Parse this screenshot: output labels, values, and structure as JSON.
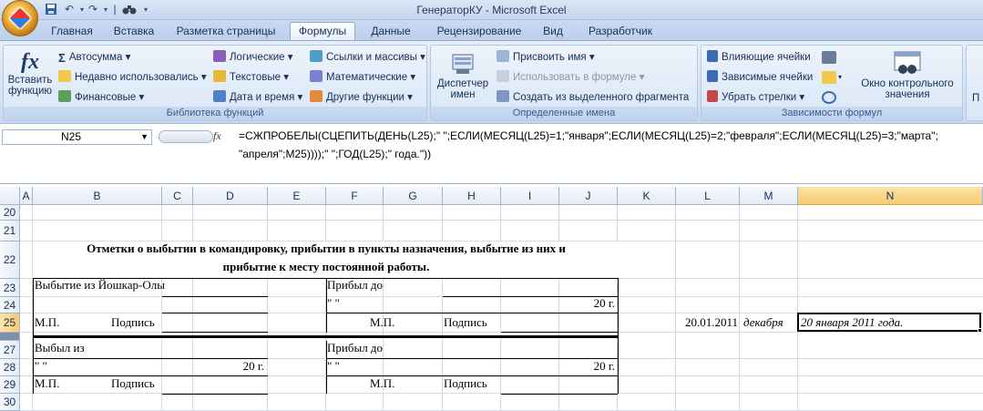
{
  "window": {
    "title": "ГенераторКУ - Microsoft Excel"
  },
  "tabs": [
    "Главная",
    "Вставка",
    "Разметка страницы",
    "Формулы",
    "Данные",
    "Рецензирование",
    "Вид",
    "Разработчик"
  ],
  "ribbon": {
    "insert_function": [
      "Вставить",
      "функцию"
    ],
    "lib": {
      "autosum": "Автосумма",
      "recent": "Недавно использовались",
      "financial": "Финансовые",
      "logical": "Логические",
      "text": "Текстовые",
      "datetime": "Дата и время",
      "lookup": "Ссылки и массивы",
      "math": "Математические",
      "more": "Другие функции",
      "label": "Библиотека функций"
    },
    "names": {
      "manager": [
        "Диспетчер",
        "имен"
      ],
      "define": "Присвоить имя",
      "use": "Использовать в формуле",
      "create": "Создать из выделенного фрагмента",
      "label": "Определенные имена"
    },
    "audit": {
      "precedents": "Влияющие ячейки",
      "dependents": "Зависимые ячейки",
      "remove": "Убрать стрелки",
      "watch": [
        "Окно контрольного",
        "значения"
      ],
      "label": "Зависимости формул"
    },
    "cut_label": "П"
  },
  "formula_bar": {
    "name_box": "N25",
    "fx": "fx",
    "formula": "=СЖПРОБЕЛЫ(СЦЕПИТЬ(ДЕНЬ(L25);\" \";ЕСЛИ(МЕСЯЦ(L25)=1;\"января\";ЕСЛИ(МЕСЯЦ(L25)=2;\"февраля\";ЕСЛИ(МЕСЯЦ(L25)=3;\"марта\";\n\"апреля\";M25))));\" \";ГОД(L25);\" года.\"))"
  },
  "columns": [
    "A",
    "B",
    "C",
    "D",
    "E",
    "F",
    "G",
    "H",
    "I",
    "J",
    "K",
    "L",
    "M",
    "N"
  ],
  "rows": [
    "20",
    "21",
    "22",
    "23",
    "24",
    "25",
    "27",
    "28",
    "29",
    "30"
  ],
  "cells": {
    "title1": "Отметки о выбытии в командировку, прибытии в пункты назначения, выбытие из них и",
    "title2": "прибытие к месту постоянной работы.",
    "b23": "Выбытие из Йошкар-Олы",
    "f23": "Прибыл до",
    "f24": "\"          \"",
    "j24": "20     г.",
    "b25": "М.П.",
    "b25p": "Подпись",
    "f25": "М.П.",
    "h25": "Подпись",
    "l25": "20.01.2011",
    "m25": "декабря",
    "n25": "20 января 2011 года.",
    "b27": "Выбыл из",
    "f27": "Прибыл до",
    "b28": "\"          \"",
    "d28": "20     г.",
    "f28": "\"          \"",
    "j28": "20     г.",
    "b29": "М.П.",
    "b29p": "Подпись",
    "f29": "М.П.",
    "h29": "Подпись"
  }
}
